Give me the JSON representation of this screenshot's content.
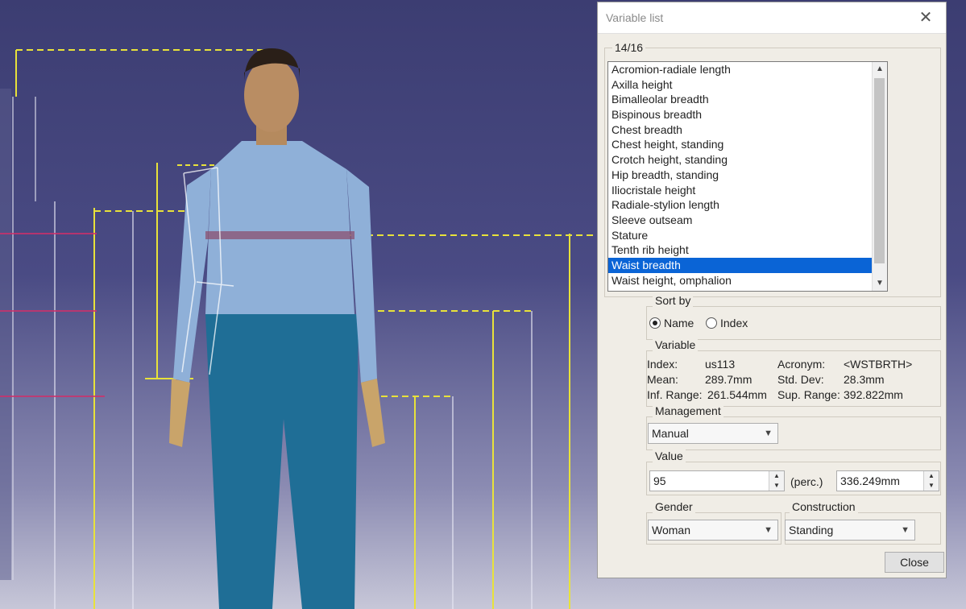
{
  "dialog": {
    "title": "Variable list",
    "count": "14/16",
    "variables": [
      "Acromion-radiale length",
      "Axilla height",
      "Bimalleolar breadth",
      "Bispinous breadth",
      "Chest breadth",
      "Chest height, standing",
      "Crotch height, standing",
      "Hip breadth, standing",
      "Iliocristale height",
      "Radiale-stylion length",
      "Sleeve outseam",
      "Stature",
      "Tenth rib height",
      "Waist breadth",
      "Waist height, omphalion"
    ],
    "selected_variable": "Waist breadth",
    "sort_by": {
      "label": "Sort by",
      "options": [
        "Name",
        "Index"
      ],
      "selected": "Name"
    },
    "variable_info": {
      "label": "Variable",
      "index_label": "Index:",
      "index_value": "us113",
      "acronym_label": "Acronym:",
      "acronym_value": "<WSTBRTH>",
      "mean_label": "Mean:",
      "mean_value": "289.7mm",
      "std_label": "Std. Dev:",
      "std_value": "28.3mm",
      "inf_label": "Inf. Range:",
      "inf_value": "261.544mm",
      "sup_label": "Sup. Range:",
      "sup_value": "392.822mm"
    },
    "management": {
      "label": "Management",
      "value": "Manual"
    },
    "value_group": {
      "label": "Value",
      "percentile": "95",
      "unit_label": "(perc.)",
      "measure": "336.249mm"
    },
    "gender": {
      "label": "Gender",
      "value": "Woman"
    },
    "construction": {
      "label": "Construction",
      "value": "Standing"
    },
    "close_label": "Close"
  },
  "colors": {
    "viewport_top": "#3c3d72",
    "selection": "#0a64d6",
    "dialog_bg": "#f0ede6",
    "measure_line": "#e8e23a",
    "manikin_shirt": "#8fb0d8",
    "manikin_pants": "#1f6e96"
  }
}
